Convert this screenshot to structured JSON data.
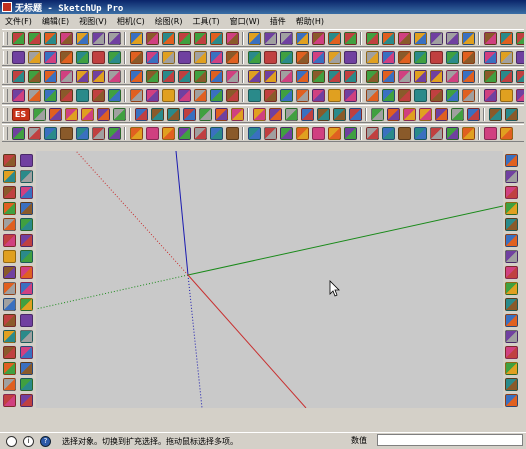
{
  "window": {
    "title": "无标题 - SketchUp Pro",
    "app_icon": "sketchup-app-icon"
  },
  "menu": {
    "items": [
      "文件(F)",
      "编辑(E)",
      "视图(V)",
      "相机(C)",
      "绘图(R)",
      "工具(T)",
      "窗口(W)",
      "插件",
      "帮助(H)"
    ]
  },
  "toolbar_rows": [
    {
      "name": "toolbar-row-1",
      "count": 34
    },
    {
      "name": "toolbar-row-2",
      "count": 36
    },
    {
      "name": "toolbar-row-3",
      "count": 34
    },
    {
      "name": "toolbar-row-4",
      "count": 34
    },
    {
      "name": "toolbar-row-5",
      "count": 30,
      "badge": "ES"
    },
    {
      "name": "toolbar-row-6",
      "count": 30
    }
  ],
  "toolbar_palette": [
    "#c04040",
    "#3a70c0",
    "#e0a020",
    "#40a040",
    "#8a5a2a",
    "#7040a0",
    "#e06020",
    "#2a8a8a",
    "#a0a0a0",
    "#d04080"
  ],
  "left_tools_count": 16,
  "right_views_count": 16,
  "viewport": {
    "background": "#c9c9c9",
    "axis_colors": {
      "red": "#c83030",
      "green": "#1a8a1a",
      "blue": "#1a1ab0"
    }
  },
  "status": {
    "icons": [
      "geo-location-icon",
      "credits-icon",
      "help-icon"
    ],
    "message": "选择对象。切换到扩充选择。拖动鼠标选择多项。",
    "value_label": "数值",
    "value": ""
  }
}
